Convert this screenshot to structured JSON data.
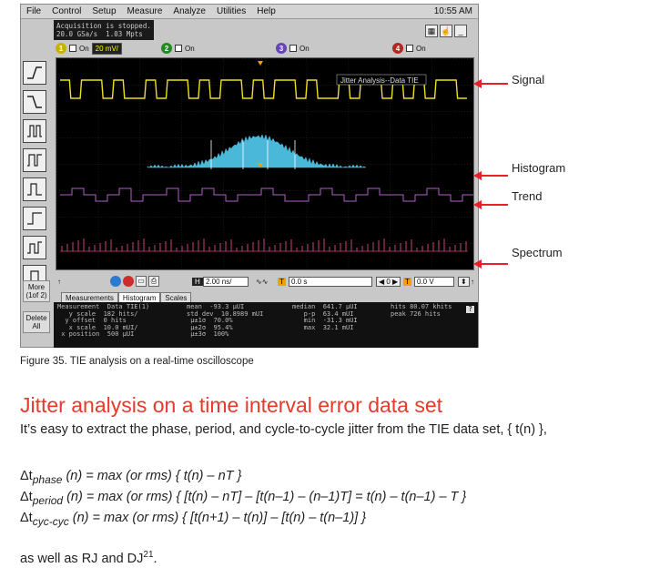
{
  "scope": {
    "menu": [
      "File",
      "Control",
      "Setup",
      "Measure",
      "Analyze",
      "Utilities",
      "Help"
    ],
    "clock": "10:55 AM",
    "status_line1": "Acquisition is stopped.",
    "status_line2": "20.0 GSa/s  1.03 Mpts",
    "channels": [
      {
        "num": "1",
        "label": "On",
        "volts": "20 mV/",
        "color": "#f0e020"
      },
      {
        "num": "2",
        "label": "On",
        "color": "#22aa22"
      },
      {
        "num": "3",
        "label": "On",
        "color": "#7755cc"
      },
      {
        "num": "4",
        "label": "On",
        "color": "#cc2222"
      }
    ],
    "screen_label": "Jitter Analysis--Data TIE",
    "more_btn": "More (1of 2)",
    "delete_btn": "Delete All",
    "timebase": "2.00 ns/",
    "delay": "0.0 s",
    "trigger_level": "0.0 V",
    "tabs": [
      "Measurements",
      "Histogram",
      "Scales"
    ],
    "meas_col1": "Measurement  Data TIE(1)\n   y scale  182 hits/\n  y offset  0 hits\n   x scale  10.0 mUI/\n x position  500 µUI",
    "meas_col2": "mean  -93.3 µUI\nstd dev  10.8989 mUI\n µ±1σ  70.0%\n µ±2σ  95.4%\n µ±3σ  100%",
    "meas_col3": "median  641.7 µUI\n   p-p  63.4 mUI\n   min  -31.3 mUI\n   max  32.1 mUI",
    "meas_col4": "hits 80.07 khits\npeak 726 hits"
  },
  "labels": {
    "signal": "Signal",
    "histogram": "Histogram",
    "trend": "Trend",
    "spectrum": "Spectrum"
  },
  "colors": {
    "signal": "#f0e020",
    "histogram": "#4ab8d8",
    "trend": "#b060c8",
    "spectrum": "#c8407a",
    "arrow": "#e8202a",
    "heading": "#e63a2c"
  },
  "caption": "Figure 35. TIE analysis on a real-time oscilloscope",
  "heading": "Jitter analysis on a time interval error data set",
  "intro": "It’s easy to extract the phase, period, and cycle-to-cycle jitter from the TIE data set, { t(n) },",
  "equations": {
    "phase_sub": "phase",
    "phase_rest": " = max (or rms) { t(n) – nT }",
    "period_sub": "period",
    "period_rest": " = max (or rms) { [t(n) – nT] – [t(n–1) – (n–1)T] = t(n) – t(n–1) – T }",
    "cyc_sub": "cyc-cyc",
    "cyc_rest": " = max (or rms) { [t(n+1) – t(n)] – [t(n) – t(n–1)] }",
    "delta": "Δt",
    "n": " (n)"
  },
  "closing": "as well as RJ and DJ",
  "closing_sup": "21",
  "closing_end": "."
}
